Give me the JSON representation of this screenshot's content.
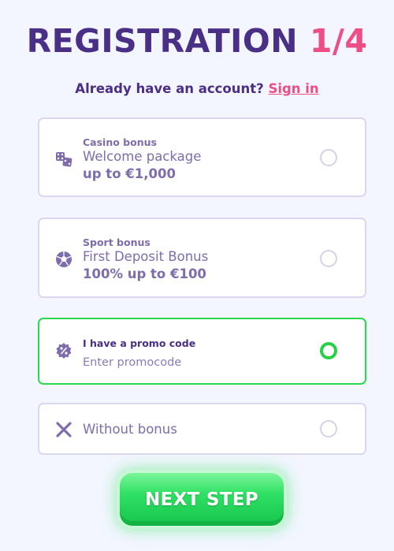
{
  "header": {
    "title": "REGISTRATION",
    "step": "1/4",
    "question": "Already have an account?",
    "signin_link": "Sign in"
  },
  "options": {
    "casino": {
      "category": "Casino bonus",
      "name": "Welcome package",
      "amount": "up to €1,000",
      "icon": "dice-icon",
      "selected": false
    },
    "sport": {
      "category": "Sport bonus",
      "name": "First Deposit Bonus",
      "amount": "100% up to €100",
      "icon": "soccer-ball-icon",
      "selected": false
    },
    "promo": {
      "label": "I have a promo code",
      "placeholder": "Enter promocode",
      "value": "",
      "icon": "percent-badge-icon",
      "selected": true
    },
    "none": {
      "label": "Without bonus",
      "icon": "x-icon",
      "selected": false
    }
  },
  "next_button": {
    "label": "NEXT STEP"
  },
  "colors": {
    "brand_purple": "#4a2f86",
    "accent_pink": "#ee4e86",
    "muted_purple": "#7f6cad",
    "selected_green": "#2bd94f",
    "background": "#f3f6ff"
  }
}
